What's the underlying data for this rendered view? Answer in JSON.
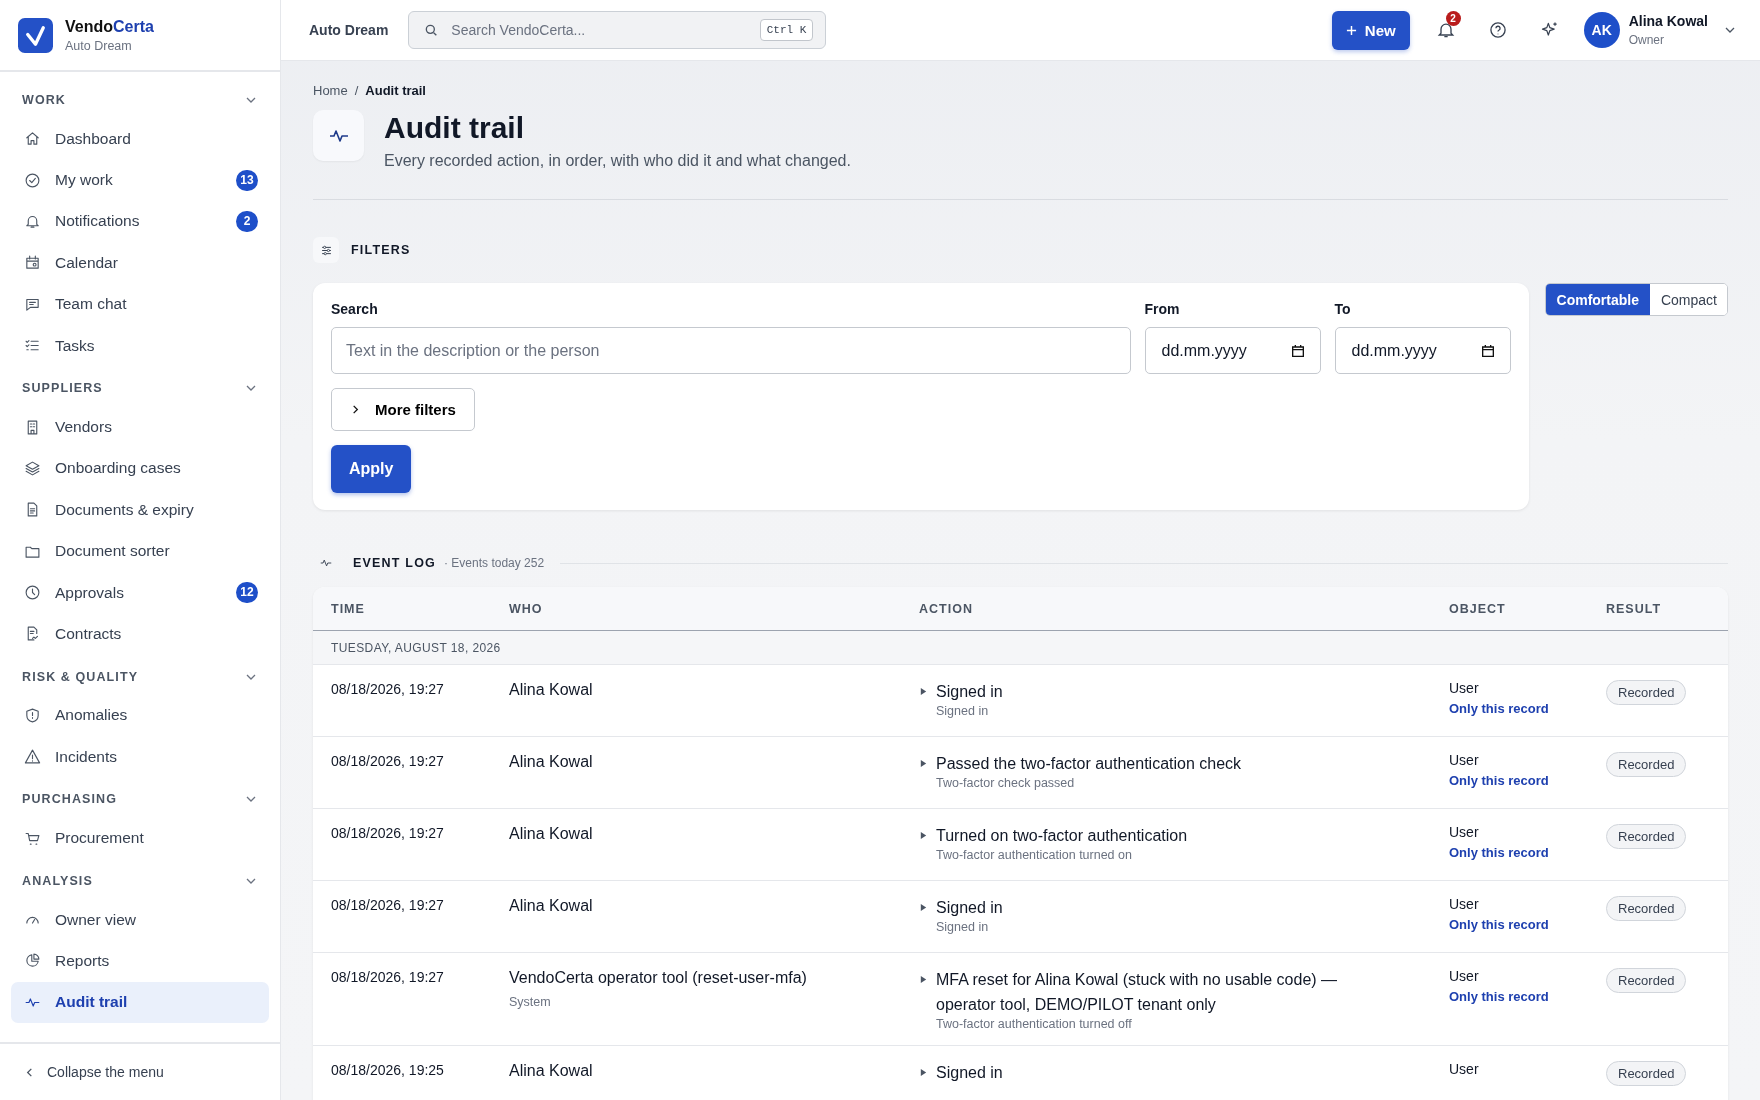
{
  "brand": {
    "name_first": "Vendo",
    "name_second": "Certa",
    "subtitle": "Auto Dream"
  },
  "sidebar": {
    "sections": [
      {
        "title": "WORK",
        "expanded": true,
        "items": [
          {
            "label": "Dashboard",
            "selected": false
          },
          {
            "label": "My work",
            "badge": "13",
            "selected": false
          },
          {
            "label": "Notifications",
            "badge": "2",
            "selected": false
          },
          {
            "label": "Calendar",
            "selected": false
          },
          {
            "label": "Team chat",
            "selected": false
          },
          {
            "label": "Tasks",
            "selected": false
          }
        ]
      },
      {
        "title": "SUPPLIERS",
        "expanded": true,
        "items": [
          {
            "label": "Vendors",
            "selected": false
          },
          {
            "label": "Onboarding cases",
            "selected": false
          },
          {
            "label": "Documents & expiry",
            "selected": false
          },
          {
            "label": "Document sorter",
            "selected": false
          },
          {
            "label": "Approvals",
            "badge": "12",
            "selected": false
          },
          {
            "label": "Contracts",
            "selected": false
          }
        ]
      },
      {
        "title": "RISK & QUALITY",
        "expanded": true,
        "items": [
          {
            "label": "Anomalies",
            "selected": false
          },
          {
            "label": "Incidents",
            "selected": false
          }
        ]
      },
      {
        "title": "PURCHASING",
        "expanded": true,
        "items": [
          {
            "label": "Procurement",
            "selected": false
          }
        ]
      },
      {
        "title": "ANALYSIS",
        "expanded": true,
        "items": [
          {
            "label": "Owner view",
            "selected": false
          },
          {
            "label": "Reports",
            "selected": false
          },
          {
            "label": "Audit trail",
            "selected": true
          }
        ]
      }
    ],
    "collapse": "Collapse the menu"
  },
  "topbar": {
    "workspace": "Auto Dream",
    "search": {
      "placeholder": "Search VendoCerta...",
      "shortcut": "Ctrl K"
    },
    "new_button": "New",
    "notification_count": "2",
    "user": {
      "initials": "AK",
      "name": "Alina Kowal",
      "role": "Owner"
    }
  },
  "breadcrumb": [
    "Home",
    "Audit trail"
  ],
  "breadcrumb_separator": "/",
  "title": "Audit trail",
  "subtitle": "Every recorded action, in order, with who did it and what changed.",
  "filters": {
    "title": "FILTERS",
    "search": {
      "label": "Search",
      "placeholder": "Text in the description or the person"
    },
    "from": {
      "label": "From",
      "placeholder": "dd.mm.yyyy"
    },
    "to": {
      "label": "To",
      "placeholder": "dd.mm.yyyy"
    },
    "more_filters": "More filters",
    "apply": "Apply"
  },
  "density": [
    {
      "label": "Comfortable",
      "selected": true
    },
    {
      "label": "Compact",
      "selected": false
    }
  ],
  "event_log": {
    "title": "EVENT LOG",
    "count": "· Events today 252"
  },
  "table": {
    "columns": [
      "TIME",
      "WHO",
      "ACTION",
      "OBJECT",
      "RESULT"
    ],
    "groups": [
      {
        "label": "TUESDAY, AUGUST 18, 2026",
        "rows": [
          {
            "time": "08/18/2026, 19:27",
            "who": "Alina Kowal",
            "action": "Signed in",
            "detail": "Signed in",
            "expanded": false,
            "object": "User",
            "object_link": "Only this record",
            "result": "Recorded"
          },
          {
            "time": "08/18/2026, 19:27",
            "who": "Alina Kowal",
            "action": "Passed the two-factor authentication check",
            "detail": "Two-factor check passed",
            "expanded": false,
            "object": "User",
            "object_link": "Only this record",
            "result": "Recorded"
          },
          {
            "time": "08/18/2026, 19:27",
            "who": "Alina Kowal",
            "action": "Turned on two-factor authentication",
            "detail": "Two-factor authentication turned on",
            "expanded": false,
            "object": "User",
            "object_link": "Only this record",
            "result": "Recorded"
          },
          {
            "time": "08/18/2026, 19:27",
            "who": "Alina Kowal",
            "action": "Signed in",
            "detail": "Signed in",
            "expanded": false,
            "object": "User",
            "object_link": "Only this record",
            "result": "Recorded"
          },
          {
            "time": "08/18/2026, 19:27",
            "who": "VendoCerta operator tool (reset-user-mfa)",
            "who_sub": "System",
            "action": "MFA reset for Alina Kowal (stuck with no usable code) — operator tool, DEMO/PILOT tenant only",
            "detail": "Two-factor authentication turned off",
            "expanded": false,
            "object": "User",
            "object_link": "Only this record",
            "result": "Recorded"
          },
          {
            "time": "08/18/2026, 19:25",
            "who": "Alina Kowal",
            "action": "Signed in",
            "expanded": false,
            "object": "User",
            "result": "Recorded"
          }
        ]
      }
    ]
  }
}
